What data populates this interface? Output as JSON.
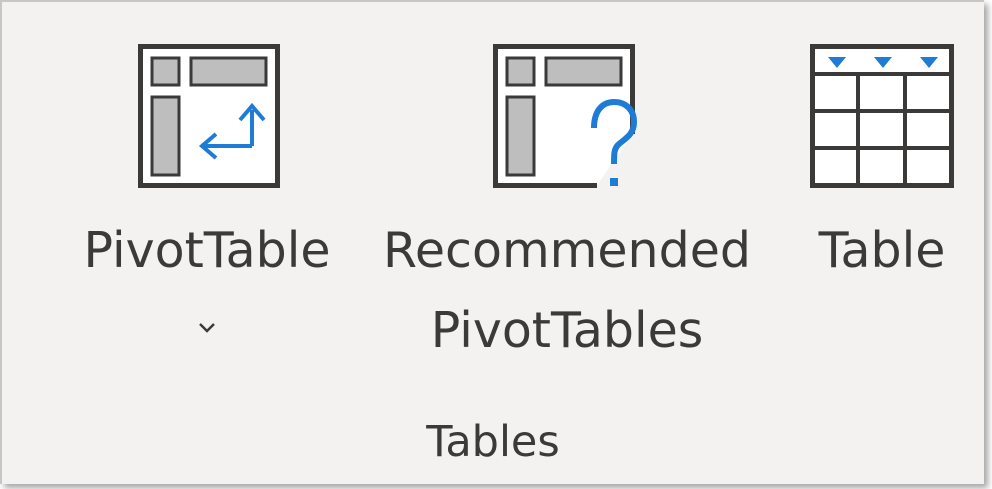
{
  "ribbon_group": {
    "label": "Tables",
    "commands": [
      {
        "label": "PivotTable",
        "has_dropdown": true,
        "icon": "pivottable-icon"
      },
      {
        "label_line1": "Recommended",
        "label_line2": "PivotTables",
        "icon": "recommended-pivottables-icon"
      },
      {
        "label": "Table",
        "icon": "table-icon"
      }
    ]
  },
  "colors": {
    "background": "#f3f2f1",
    "icon_frame": "#3b3a39",
    "icon_fill": "#bebebe",
    "accent_blue": "#1e7cd6",
    "text": "#3b3a39"
  }
}
